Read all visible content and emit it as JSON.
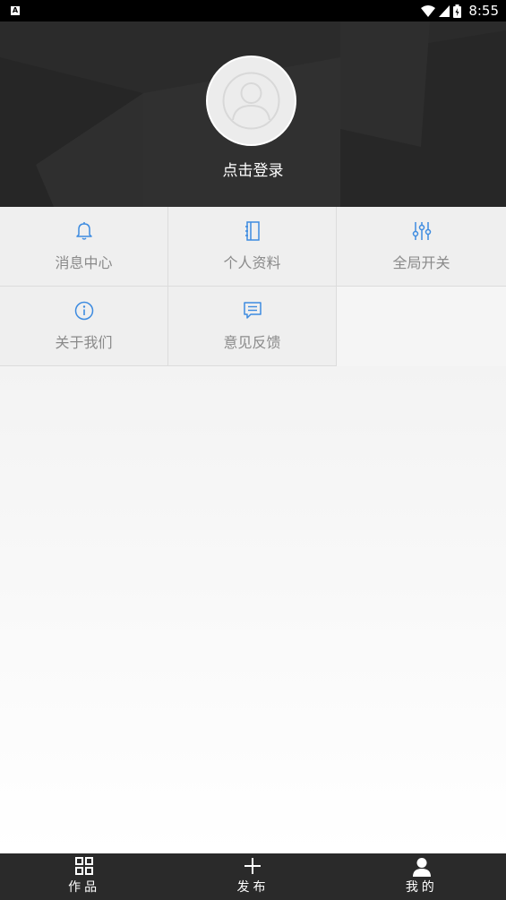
{
  "status_bar": {
    "time": "8:55",
    "notification_icon_label": "A"
  },
  "profile": {
    "login_label": "点击登录"
  },
  "menu": {
    "items": [
      {
        "label": "消息中心",
        "icon": "bell-icon"
      },
      {
        "label": "个人资料",
        "icon": "notebook-icon"
      },
      {
        "label": "全局开关",
        "icon": "sliders-icon"
      },
      {
        "label": "关于我们",
        "icon": "info-icon"
      },
      {
        "label": "意见反馈",
        "icon": "feedback-icon"
      }
    ]
  },
  "bottom_nav": {
    "items": [
      {
        "label": "作品",
        "icon": "grid-icon"
      },
      {
        "label": "发布",
        "icon": "plus-icon"
      },
      {
        "label": "我的",
        "icon": "user-icon"
      }
    ],
    "active_index": 2
  },
  "colors": {
    "header_bg": "#2b2b2b",
    "icon_accent": "#3d8be0",
    "menu_label": "#8a8a8a",
    "bottom_nav_bg": "#2a2a2a"
  }
}
